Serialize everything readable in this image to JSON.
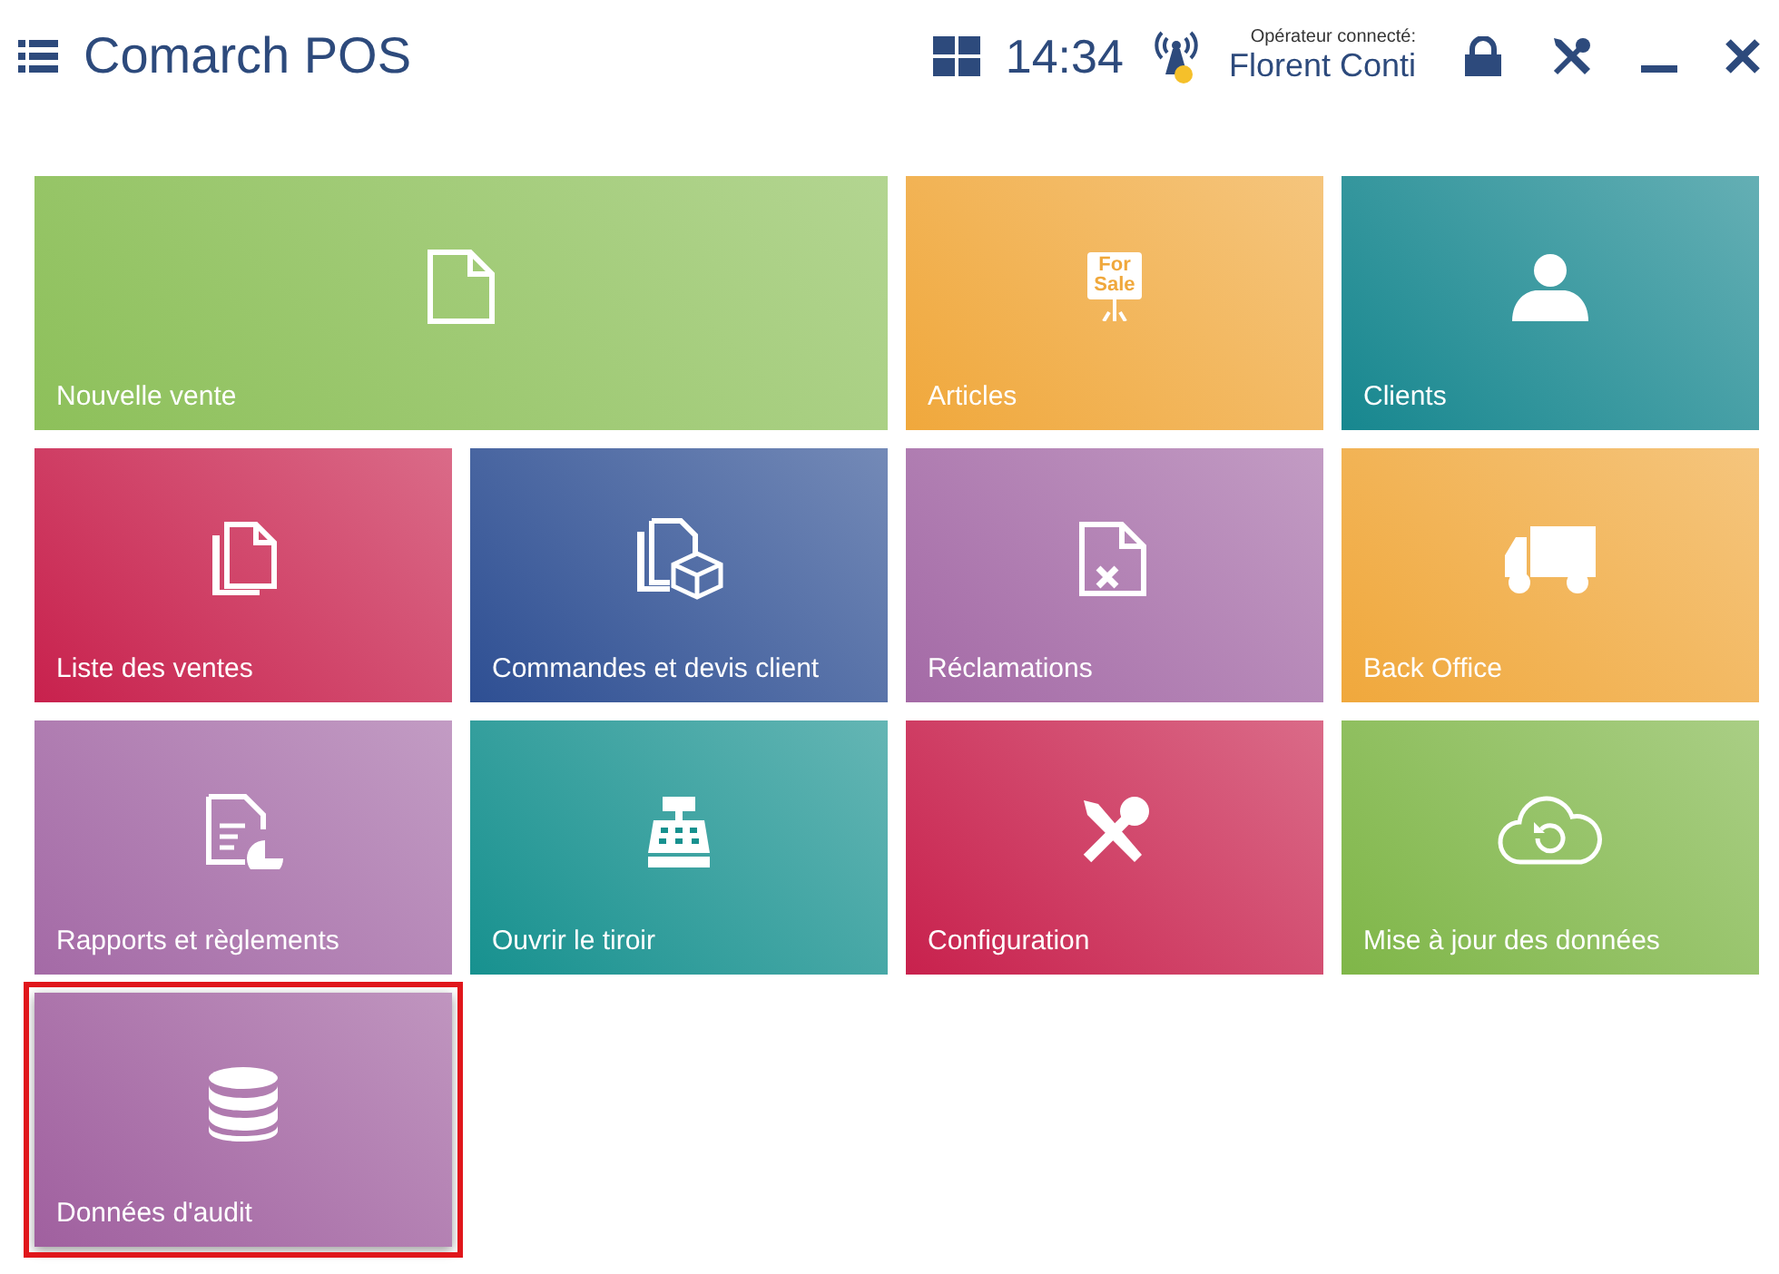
{
  "header": {
    "title": "Comarch POS",
    "time": "14:34",
    "operator_label": "Opérateur connecté:",
    "operator_name": "Florent Conti"
  },
  "tiles": [
    {
      "label": "Nouvelle vente",
      "color": "#8dc05a",
      "wide": true,
      "highlighted": false
    },
    {
      "label": "Articles",
      "color": "#f0a83c",
      "wide": false,
      "highlighted": false,
      "sign_text": [
        "For",
        "Sale"
      ]
    },
    {
      "label": "Clients",
      "color": "#17878f",
      "wide": false,
      "highlighted": false
    },
    {
      "label": "Liste des ventes",
      "color": "#c8214d",
      "wide": false,
      "highlighted": false
    },
    {
      "label": "Commandes et devis client",
      "color": "#2e4f93",
      "wide": false,
      "highlighted": false
    },
    {
      "label": "Réclamations",
      "color": "#a46aa6",
      "wide": false,
      "highlighted": false
    },
    {
      "label": "Back Office",
      "color": "#f0a83c",
      "wide": false,
      "highlighted": false
    },
    {
      "label": "Rapports et règlements",
      "color": "#a46aa6",
      "wide": false,
      "highlighted": false
    },
    {
      "label": "Ouvrir le tiroir",
      "color": "#17918f",
      "wide": false,
      "highlighted": false
    },
    {
      "label": "Configuration",
      "color": "#c8214d",
      "wide": false,
      "highlighted": false
    },
    {
      "label": "Mise à jour des données",
      "color": "#7fb648",
      "wide": false,
      "highlighted": false
    },
    {
      "label": "Données d'audit",
      "color": "#a0609f",
      "wide": false,
      "highlighted": true
    }
  ]
}
